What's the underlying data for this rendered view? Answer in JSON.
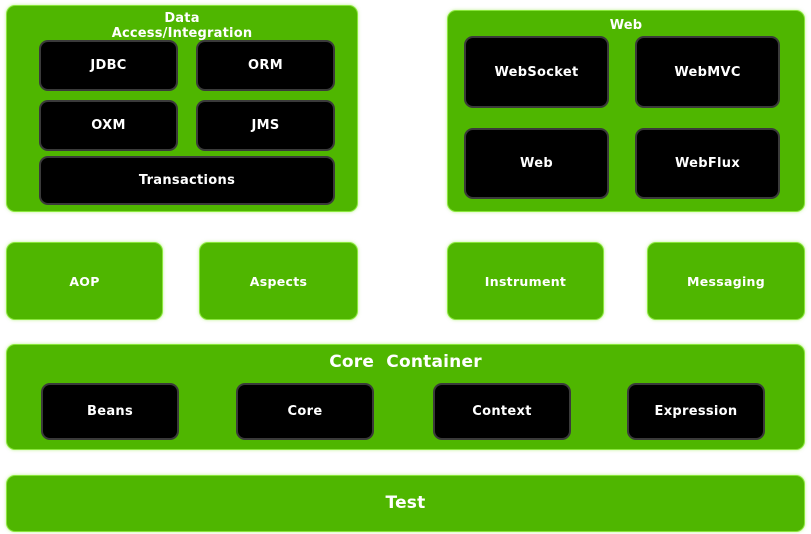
{
  "diagram": {
    "theme": {
      "green": "#4fb600",
      "green_glow": "#8ae63c",
      "chip_black": "#000000",
      "chip_border": "#3a3a3a",
      "text_white": "#ffffff",
      "background": "#ffffff"
    }
  },
  "data_access": {
    "title": "Data\nAccess/Integration",
    "modules": [
      {
        "label": "JDBC"
      },
      {
        "label": "ORM"
      },
      {
        "label": "OXM"
      },
      {
        "label": "JMS"
      },
      {
        "label": "Transactions"
      }
    ]
  },
  "web": {
    "title": "Web",
    "modules": [
      {
        "label": "WebSocket"
      },
      {
        "label": "WebMVC"
      },
      {
        "label": "Web"
      },
      {
        "label": "WebFlux"
      }
    ]
  },
  "standalone": {
    "modules": [
      {
        "label": "AOP"
      },
      {
        "label": "Aspects"
      },
      {
        "label": "Instrument"
      },
      {
        "label": "Messaging"
      }
    ]
  },
  "core_container": {
    "title": "Core  Container",
    "modules": [
      {
        "label": "Beans"
      },
      {
        "label": "Core"
      },
      {
        "label": "Context"
      },
      {
        "label": "Expression"
      }
    ]
  },
  "test": {
    "title": "Test"
  }
}
